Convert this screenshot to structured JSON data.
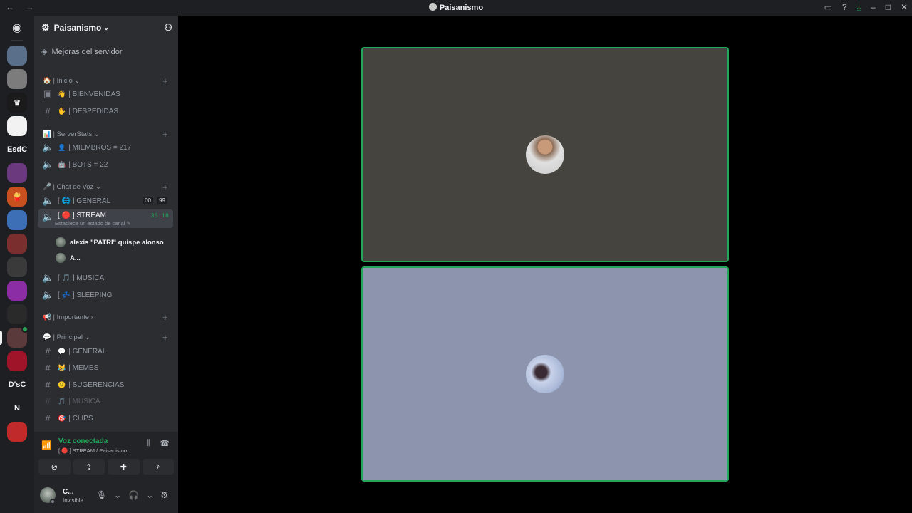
{
  "titlebar": {
    "nav": "← →",
    "title": "Paisanismo",
    "icons": [
      "inbox-icon",
      "help-icon",
      "download-icon",
      "minimize-icon",
      "maximize-icon",
      "close-icon"
    ]
  },
  "guilds": {
    "items": [
      {
        "name": "guild-1",
        "color": "#5a6f8a",
        "label": ""
      },
      {
        "name": "guild-2",
        "color": "#7c7c7c",
        "label": ""
      },
      {
        "name": "guild-3",
        "color": "#1a1a1a",
        "label": "♛"
      },
      {
        "name": "guild-4",
        "color": "#f2f2f2",
        "label": "✿"
      },
      {
        "name": "guild-esdc",
        "color": "",
        "label": "EsdC"
      },
      {
        "name": "guild-6",
        "color": "#6b3a7e",
        "label": ""
      },
      {
        "name": "guild-7",
        "color": "#c8501e",
        "label": "🍟"
      },
      {
        "name": "guild-8",
        "color": "#3d6fb6",
        "label": ""
      },
      {
        "name": "guild-9",
        "color": "#7a2e2e",
        "label": ""
      },
      {
        "name": "guild-10",
        "color": "#3a3a3a",
        "label": ""
      },
      {
        "name": "guild-11",
        "color": "#8b2da5",
        "label": ""
      },
      {
        "name": "guild-12",
        "color": "#2a2a2a",
        "label": ""
      },
      {
        "name": "guild-13",
        "color": "#5a3a3a",
        "label": ""
      },
      {
        "name": "guild-14",
        "color": "#a0142a",
        "label": ""
      },
      {
        "name": "guild-dsc",
        "color": "",
        "label": "D'sC"
      },
      {
        "name": "guild-n",
        "color": "",
        "label": "N"
      },
      {
        "name": "guild-17",
        "color": "#c02a2a",
        "label": ""
      }
    ]
  },
  "server": {
    "name": "Paisanismo",
    "boost": "Mejoras del servidor"
  },
  "categories": {
    "inicio": "| Inicio",
    "stats": "| ServerStats",
    "voz": "| Chat de Voz",
    "importante": "| Importante",
    "principal": "| Principal"
  },
  "channels": {
    "bienvenidas": {
      "emoji": "👋",
      "label": "| BIENVENIDAS"
    },
    "despedidas": {
      "emoji": "🖐",
      "label": "| DESPEDIDAS"
    },
    "miembros": {
      "emoji": "👤",
      "label": "| MIEMBROS = 217"
    },
    "bots": {
      "emoji": "🤖",
      "label": "| BOTS = 22"
    },
    "general_voice": {
      "emoji": "🌐",
      "label": "[ 🌐 ] GENERAL",
      "badge1": "00",
      "badge2": "99"
    },
    "stream": {
      "label": "[ 🔴 ] STREAM",
      "timer": "35:18",
      "status": "Establece un estado de canal ✎"
    },
    "musica_voice": {
      "label": "[ 🎵 ] MUSICA"
    },
    "sleeping": {
      "label": "[ 💤 ] SLEEPING"
    },
    "general_text": {
      "emoji": "💬",
      "label": "| GENERAL"
    },
    "memes": {
      "emoji": "😹",
      "label": "| MEMES"
    },
    "sugerencias": {
      "emoji": "🙂",
      "label": "| SUGERENCIAS"
    },
    "musica_text": {
      "emoji": "🎵",
      "label": "| MUSICA"
    },
    "clips": {
      "emoji": "🎯",
      "label": "| CLIPS"
    }
  },
  "voice_users": [
    {
      "name": "alexis \"PATRI\" quispe alonso"
    },
    {
      "name": "A..."
    }
  ],
  "voicebar": {
    "title": "Voz conectada",
    "subtitle": "[ 🔴 ] STREAM / Paisanismo"
  },
  "userbar": {
    "name": "C...",
    "status": "Invisible"
  },
  "colors": {
    "accent_green": "#23a55a",
    "sidebar_bg": "#2b2d31",
    "tile1_bg": "#45443f",
    "tile2_bg": "#8c95ad"
  }
}
